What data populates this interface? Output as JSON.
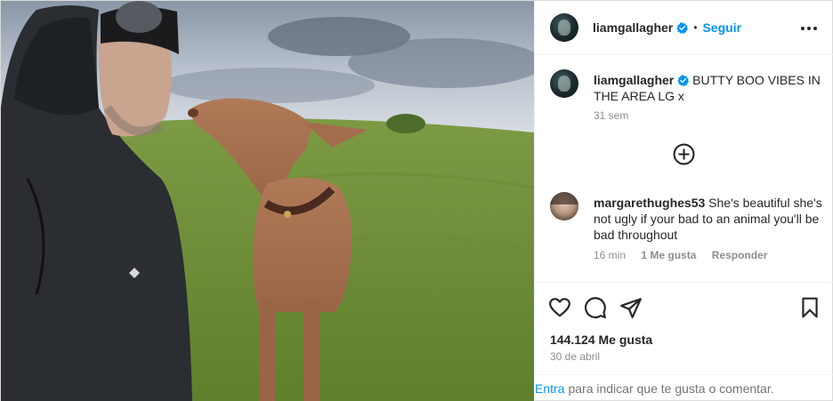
{
  "header": {
    "username": "liamgallagher",
    "separator": "•",
    "follow_label": "Seguir"
  },
  "caption": {
    "username": "liamgallagher",
    "text": "BUTTY BOO VIBES IN THE AREA LG x",
    "time": "31 sem"
  },
  "comment": {
    "username": "margarethughes53",
    "text": "She's beautiful she's not ugly if your bad to an animal you'll be bad throughout",
    "time": "16 min",
    "likes": "1 Me gusta",
    "reply_label": "Responder"
  },
  "stats": {
    "likes": "144.124 Me gusta",
    "date": "30 de abril"
  },
  "login": {
    "link_label": "Entra",
    "text": "para indicar que te gusta o comentar."
  },
  "colors": {
    "accent": "#0095f6",
    "text": "#262626",
    "muted": "#8e8e8e",
    "border": "#efefef"
  },
  "icons": [
    "verified-badge-icon",
    "more-options-icon",
    "add-comments-icon",
    "heart-icon",
    "comment-icon",
    "share-icon",
    "bookmark-icon"
  ]
}
